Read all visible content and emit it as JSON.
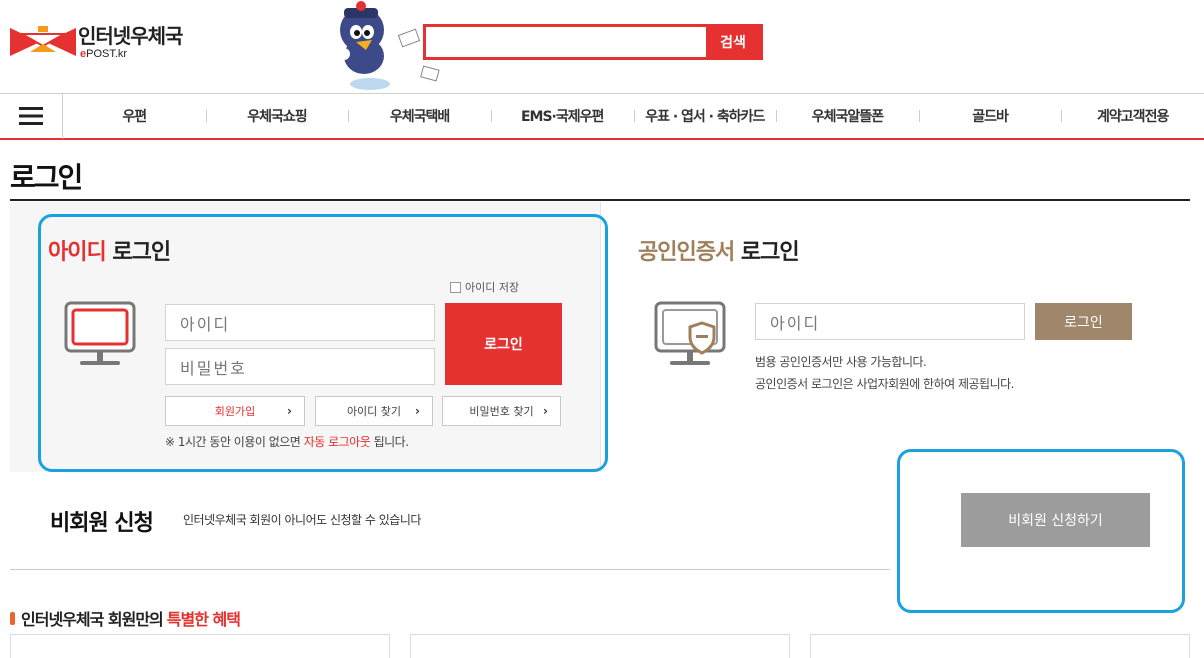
{
  "header": {
    "logo_main": "인터넷우체국",
    "logo_sub_e": "e",
    "logo_sub_rest": "POST.kr",
    "search_value": "",
    "search_button": "검색",
    "colors": {
      "brand_red": "#e5312f",
      "cert_brown": "#a0805b",
      "highlight_blue": "#1aa1e0"
    }
  },
  "nav": {
    "menu_icon": "hamburger-icon",
    "items": [
      "우편",
      "우체국쇼핑",
      "우체국택배",
      "EMS·국제우편",
      "우표 · 엽서 · 축하카드",
      "우체국알뜰폰",
      "골드바",
      "계약고객전용"
    ]
  },
  "page": {
    "title": "로그인"
  },
  "id_login": {
    "title_accent": "아이디",
    "title_rest": "로그인",
    "save_id_label": "아이디 저장",
    "id_placeholder": "아이디",
    "pw_placeholder": "비밀번호",
    "login_button": "로그인",
    "signup": "회원가입",
    "find_id": "아이디 찾기",
    "find_pw": "비밀번호 찾기",
    "notice_prefix": "※ 1시간 동안 이용이 없으면",
    "notice_accent": "자동 로그아웃",
    "notice_suffix": "됩니다."
  },
  "cert_login": {
    "title_accent": "공인인증서",
    "title_rest": "로그인",
    "id_placeholder": "아이디",
    "login_button": "로그인",
    "note1": "범용 공인인증서만 사용 가능합니다.",
    "note2": "공인인증서 로그인은 사업자회원에 한하여 제공됩니다."
  },
  "guest": {
    "title": "비회원 신청",
    "desc": "인터넷우체국 회원이 아니어도 신청할 수 있습니다",
    "button": "비회원 신청하기"
  },
  "benefits": {
    "title_prefix": "인터넷우체국 회원만의",
    "title_accent": "특별한 혜택"
  }
}
